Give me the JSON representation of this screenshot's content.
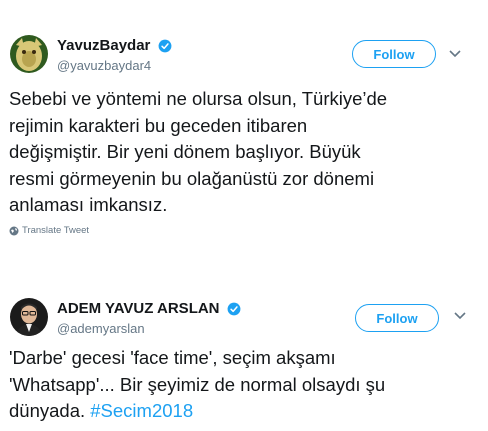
{
  "tweets": [
    {
      "display_name": "YavuzBaydar",
      "handle": "@yavuzbaydar4",
      "follow_label": "Follow",
      "text": "Sebebi ve yöntemi ne olursa olsun, Türkiye’de\nrejimin karakteri bu geceden itibaren\ndeğişmiştir. Bir yeni dönem başlıyor. Büyük\nresmi görmeyenin bu olağanüstü zor dönemi\nanlaması imkansız.",
      "translate_label": "Translate Tweet",
      "verified": true
    },
    {
      "display_name": "ADEM YAVUZ ARSLAN",
      "handle": "@ademyarslan",
      "follow_label": "Follow",
      "text": "'Darbe' gecesi 'face time', seçim akşamı\n'Whatsapp'... Bir şeyimiz de normal olsaydı şu\ndünyada. ",
      "hashtag": "#Secim2018",
      "verified": true
    }
  ],
  "colors": {
    "accent": "#1da1f2",
    "text": "#14171a",
    "secondary": "#657786"
  },
  "icons": [
    "verified-badge-icon",
    "chevron-down-icon",
    "globe-icon"
  ]
}
